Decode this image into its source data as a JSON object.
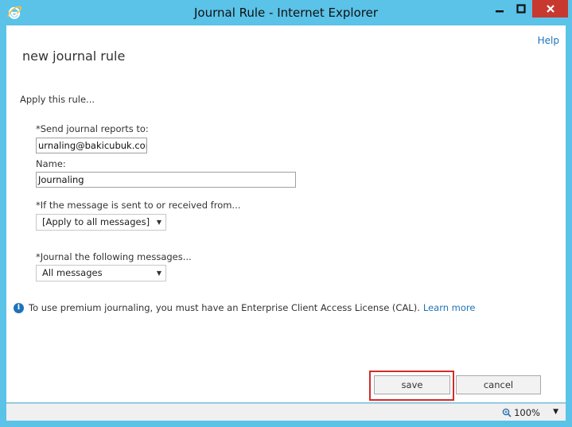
{
  "window": {
    "title": "Journal Rule - Internet Explorer"
  },
  "header": {
    "help": "Help"
  },
  "form": {
    "title": "new journal rule",
    "section": "Apply this rule...",
    "send_label": "*Send journal reports to:",
    "send_value": "urnaling@bakicubuk.com",
    "name_label": "Name:",
    "name_value": "Journaling",
    "condition_label": "*If the message is sent to or received from...",
    "condition_value": "[Apply to all messages]",
    "journal_label": "*Journal the following messages...",
    "journal_value": "All messages"
  },
  "info": {
    "text": "To use premium journaling, you must have an Enterprise Client Access License (CAL).",
    "link": "Learn more"
  },
  "buttons": {
    "save": "save",
    "cancel": "cancel"
  },
  "status": {
    "zoom": "100%"
  },
  "colors": {
    "titlebar": "#5bc2e8",
    "close": "#c7392f",
    "link": "#1e73b8",
    "highlight": "#d42a2a"
  }
}
